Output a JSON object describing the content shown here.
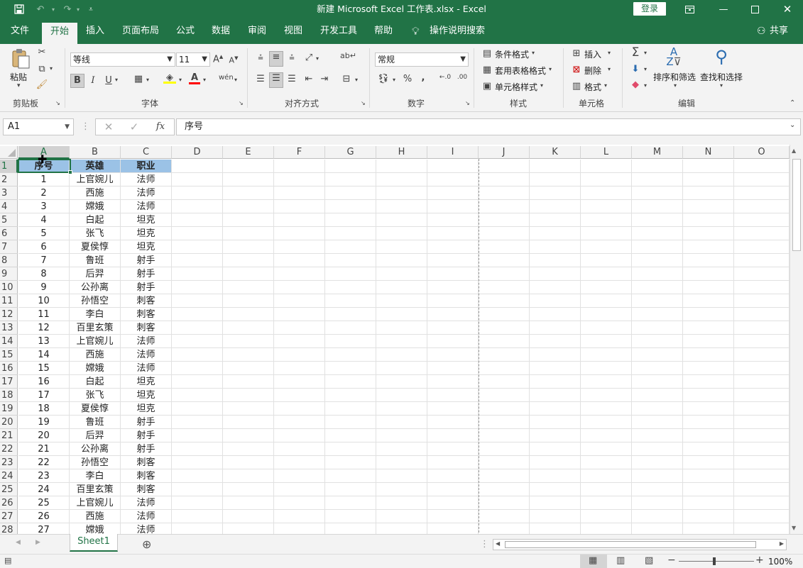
{
  "window": {
    "title": "新建 Microsoft Excel 工作表.xlsx  -  Excel",
    "login": "登录",
    "save_icon": "save-icon"
  },
  "ribbon_tabs": [
    "文件",
    "开始",
    "插入",
    "页面布局",
    "公式",
    "数据",
    "审阅",
    "视图",
    "开发工具",
    "帮助",
    "操作说明搜索",
    "共享"
  ],
  "ribbon": {
    "clipboard": {
      "paste": "粘贴",
      "label": "剪贴板"
    },
    "font": {
      "name": "等线",
      "size": "11",
      "label": "字体",
      "bold": "B",
      "italic": "I",
      "underline": "U"
    },
    "alignment": {
      "label": "对齐方式"
    },
    "number": {
      "format": "常规",
      "label": "数字",
      "percent": "%",
      "comma": ","
    },
    "styles": {
      "conditional": "条件格式",
      "table": "套用表格格式",
      "cell": "单元格样式",
      "label": "样式"
    },
    "cells": {
      "insert": "插入",
      "delete": "删除",
      "format": "格式",
      "label": "单元格"
    },
    "editing": {
      "sort": "排序和筛选",
      "find": "查找和选择",
      "label": "编辑"
    }
  },
  "formula_bar": {
    "name_box": "A1",
    "fx": "fx",
    "content": "序号"
  },
  "columns": [
    "A",
    "B",
    "C",
    "D",
    "E",
    "F",
    "G",
    "H",
    "I",
    "J",
    "K",
    "L",
    "M",
    "N",
    "O"
  ],
  "rows": [
    [
      "1",
      "序号",
      "英雄",
      "职业"
    ],
    [
      "2",
      "1",
      "上官婉儿",
      "法师"
    ],
    [
      "3",
      "2",
      "西施",
      "法师"
    ],
    [
      "4",
      "3",
      "嫦娥",
      "法师"
    ],
    [
      "5",
      "4",
      "白起",
      "坦克"
    ],
    [
      "6",
      "5",
      "张飞",
      "坦克"
    ],
    [
      "7",
      "6",
      "夏侯惇",
      "坦克"
    ],
    [
      "8",
      "7",
      "鲁班",
      "射手"
    ],
    [
      "9",
      "8",
      "后羿",
      "射手"
    ],
    [
      "10",
      "9",
      "公孙离",
      "射手"
    ],
    [
      "11",
      "10",
      "孙悟空",
      "刺客"
    ],
    [
      "12",
      "11",
      "李白",
      "刺客"
    ],
    [
      "13",
      "12",
      "百里玄策",
      "刺客"
    ],
    [
      "14",
      "13",
      "上官婉儿",
      "法师"
    ],
    [
      "15",
      "14",
      "西施",
      "法师"
    ],
    [
      "16",
      "15",
      "嫦娥",
      "法师"
    ],
    [
      "17",
      "16",
      "白起",
      "坦克"
    ],
    [
      "18",
      "17",
      "张飞",
      "坦克"
    ],
    [
      "19",
      "18",
      "夏侯惇",
      "坦克"
    ],
    [
      "20",
      "19",
      "鲁班",
      "射手"
    ],
    [
      "21",
      "20",
      "后羿",
      "射手"
    ],
    [
      "22",
      "21",
      "公孙离",
      "射手"
    ],
    [
      "23",
      "22",
      "孙悟空",
      "刺客"
    ],
    [
      "24",
      "23",
      "李白",
      "刺客"
    ],
    [
      "25",
      "24",
      "百里玄策",
      "刺客"
    ],
    [
      "26",
      "25",
      "上官婉儿",
      "法师"
    ],
    [
      "27",
      "26",
      "西施",
      "法师"
    ],
    [
      "28",
      "27",
      "嫦娥",
      "法师"
    ]
  ],
  "sheet_tabs": [
    "Sheet1"
  ],
  "status": {
    "zoom": "100%"
  },
  "colors": {
    "accent": "#217346",
    "header_fill": "#9bc2e6"
  }
}
